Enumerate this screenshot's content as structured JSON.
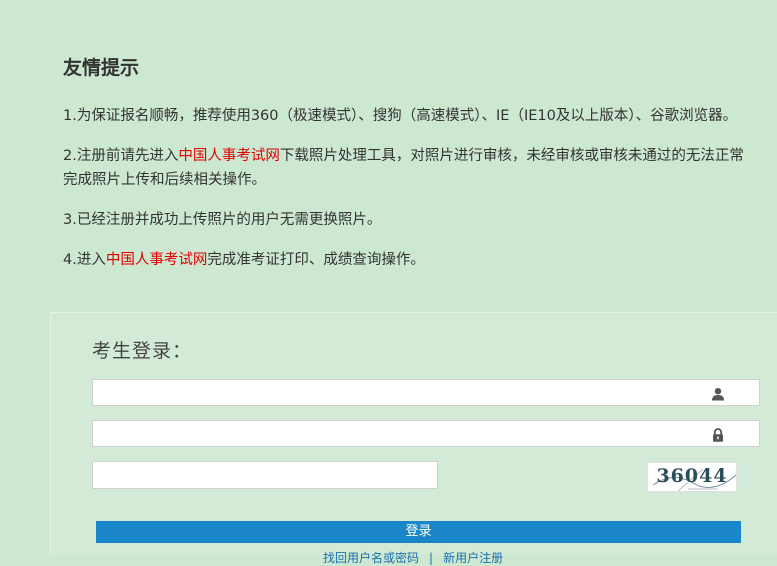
{
  "notice": {
    "title": "友情提示",
    "item1": "1.为保证报名顺畅，推荐使用360（极速模式）、搜狗（高速模式）、IE（IE10及以上版本）、谷歌浏览器。",
    "item2_prefix": "2.注册前请先进入",
    "item2_link": "中国人事考试网",
    "item2_suffix": "下载照片处理工具，对照片进行审核，未经审核或审核未通过的无法正常完成照片上传和后续相关操作。",
    "item3": "3.已经注册并成功上传照片的用户无需更换照片。",
    "item4_prefix": "4.进入",
    "item4_link": "中国人事考试网",
    "item4_suffix": "完成准考证打印、成绩查询操作。",
    "link_color": "#e00000"
  },
  "login": {
    "title": "考生登录：",
    "username": {
      "value": "",
      "placeholder": "",
      "icon": "user-icon"
    },
    "password": {
      "value": "",
      "placeholder": "",
      "icon": "lock-icon"
    },
    "captcha_input": {
      "value": "",
      "placeholder": ""
    },
    "captcha_code": "36044",
    "submit_label": "登录",
    "button_color": "#1a86c7",
    "link_forgot": "找回用户名或密码",
    "link_register": "新用户注册"
  }
}
